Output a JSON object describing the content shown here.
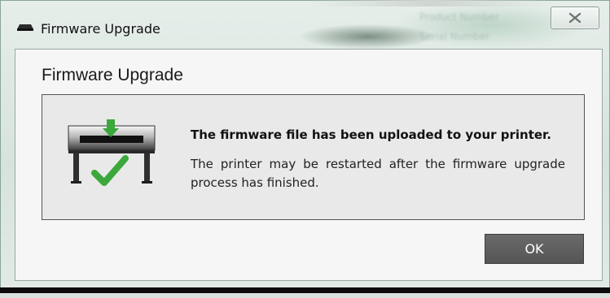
{
  "window": {
    "title": "Firmware Upgrade",
    "close_icon": "close-icon"
  },
  "dialog": {
    "heading": "Firmware Upgrade",
    "icon": "printer-upload-check-icon",
    "message_title": "The firmware file has been uploaded to your printer.",
    "message_body": "The printer may be restarted after the firmware upgrade process has finished.",
    "ok_label": "OK"
  },
  "background_ghost": {
    "line1": "Product Number",
    "line2": "Serial Number"
  },
  "colors": {
    "accent_green": "#3aa83a",
    "ok_button": "#5c5c5c",
    "panel_border": "#555555"
  }
}
